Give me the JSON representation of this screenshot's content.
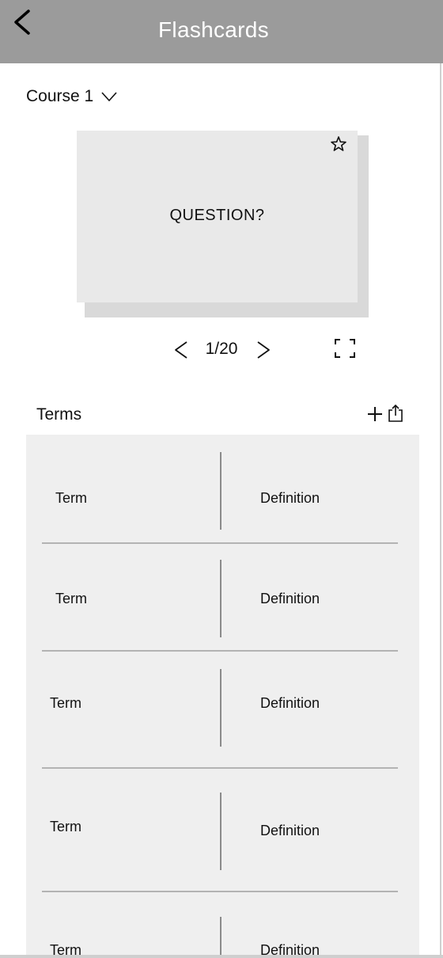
{
  "header": {
    "title": "Flashcards",
    "background": "#9b9b9b"
  },
  "course": {
    "selected": "Course 1"
  },
  "card": {
    "text": "QUESTION?",
    "favorited": false
  },
  "navigation": {
    "current": 1,
    "total": 20,
    "counter_label": "1/20"
  },
  "terms": {
    "heading": "Terms",
    "rows": [
      {
        "term": "Term",
        "definition": "Definition"
      },
      {
        "term": "Term",
        "definition": "Definition"
      },
      {
        "term": "Term",
        "definition": "Definition"
      },
      {
        "term": "Term",
        "definition": "Definition"
      },
      {
        "term": "Term",
        "definition": "Definition"
      }
    ]
  },
  "icons": {
    "back": "chevron-left-icon",
    "course_dropdown": "chevron-down-icon",
    "favorite": "star-icon",
    "previous": "chevron-left-icon",
    "next": "chevron-right-icon",
    "fullscreen": "fullscreen-icon",
    "add": "plus-icon",
    "share": "share-icon"
  }
}
